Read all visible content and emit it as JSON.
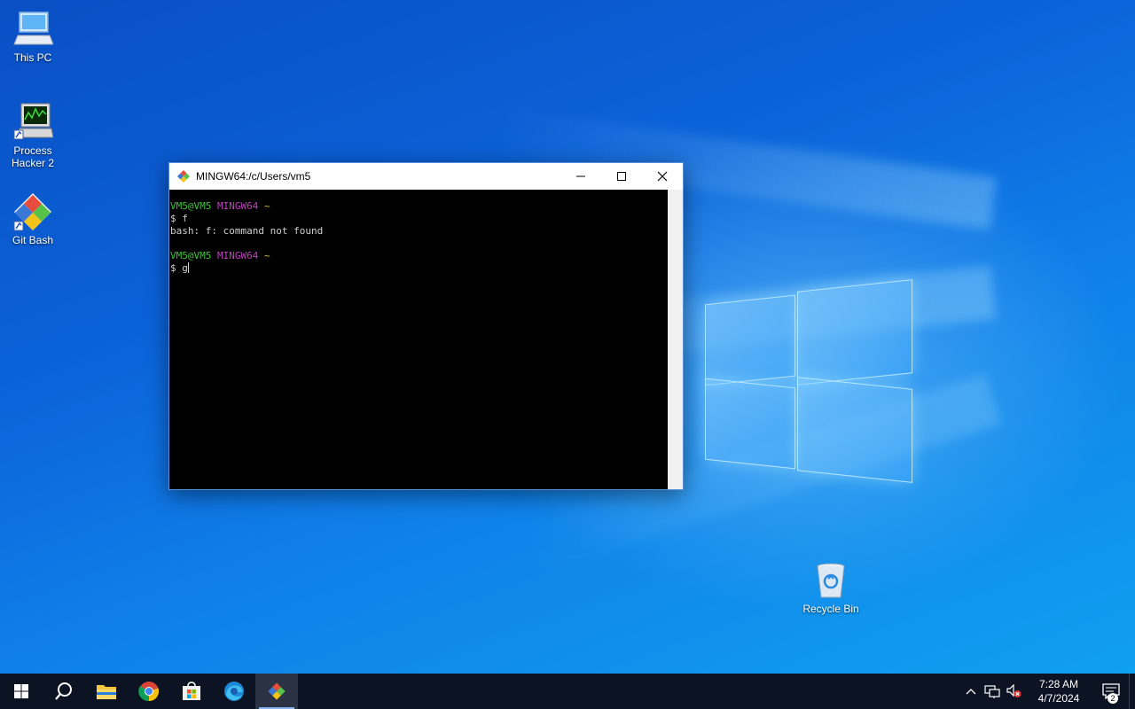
{
  "desktop": {
    "icons": [
      {
        "label": "This PC",
        "icon": "computer-icon"
      },
      {
        "label": "Process Hacker 2",
        "icon": "process-hacker-icon"
      },
      {
        "label": "Git Bash",
        "icon": "git-bash-icon"
      },
      {
        "label": "Recycle Bin",
        "icon": "recycle-bin-icon"
      }
    ]
  },
  "window": {
    "title": "MINGW64:/c/Users/vm5",
    "terminal": {
      "prompt1_user": "VM5@VM5",
      "prompt1_env": "MINGW64",
      "prompt1_dir": "~",
      "cmd1": "$ f",
      "output1": "bash: f: command not found",
      "prompt2_user": "VM5@VM5",
      "prompt2_env": "MINGW64",
      "prompt2_dir": "~",
      "cmd2": "$ g"
    }
  },
  "taskbar": {
    "apps": [
      "start-icon",
      "search-icon",
      "file-explorer-icon",
      "chrome-icon",
      "store-icon",
      "edge-icon",
      "git-bash-icon"
    ],
    "clock_time": "7:28 AM",
    "clock_date": "4/7/2024",
    "notification_count": "2"
  },
  "colors": {
    "prompt_user": "#3cc13c",
    "prompt_env": "#c040c0",
    "prompt_dir": "#c8c83c",
    "taskbar_bg": "#0c1322"
  }
}
